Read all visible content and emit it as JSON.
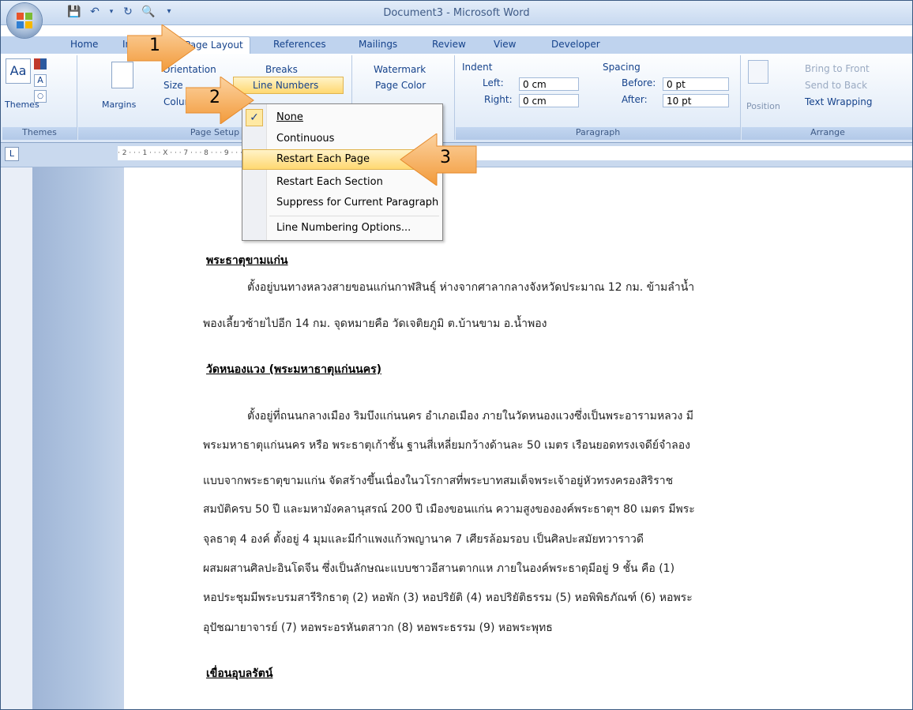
{
  "window": {
    "title": "Document3 - Microsoft Word"
  },
  "tabs": [
    "Home",
    "Insert",
    "Page Layout",
    "References",
    "Mailings",
    "Review",
    "View",
    "Developer"
  ],
  "tab_active": "Page Layout",
  "tab_insert_visible": "In",
  "ribbon": {
    "themes": {
      "button": "Themes",
      "group_label": "Themes"
    },
    "page_setup": {
      "margins": "Margins",
      "orientation": "Orientation",
      "size": "Size",
      "columns": "Columns",
      "breaks": "Breaks",
      "line_numbers": "Line Numbers",
      "group_label": "Page Setup"
    },
    "page_background": {
      "watermark": "Watermark",
      "page_color": "Page Color"
    },
    "paragraph": {
      "indent_label": "Indent",
      "left_label": "Left:",
      "left_value": "0 cm",
      "right_label": "Right:",
      "right_value": "0 cm",
      "spacing_label": "Spacing",
      "before_label": "Before:",
      "before_value": "0 pt",
      "after_label": "After:",
      "after_value": "10 pt",
      "group_label": "Paragraph"
    },
    "arrange": {
      "position": "Position",
      "bring_to_front": "Bring to Front",
      "send_to_back": "Send to Back",
      "text_wrapping": "Text Wrapping",
      "group_label": "Arrange"
    }
  },
  "ruler": {
    "marks": "· 2 · · · 1 · · · X · · · 7 · · · 8 · · · 9 · · · 10 · · · 11 · · · 12 · · · 13 · · · 14 · · · 15 · · ·△· · · 17 · · · 18 ·"
  },
  "line_numbers_menu": {
    "items": [
      "None",
      "Continuous",
      "Restart Each Page",
      "Restart Each Section",
      "Suppress for Current Paragraph",
      "Line Numbering Options..."
    ],
    "checked": "None",
    "highlighted": "Restart Each Page"
  },
  "callouts": [
    "1",
    "2",
    "3"
  ],
  "document": {
    "heading1": "พระธาตุขามแก่น",
    "p1_line1": "ตั้งอยู่บนทางหลวงสายขอนแก่นกาฬสินธุ์  ห่างจากศาลากลางจังหวัดประมาณ  12  กม.  ข้ามลำน้ำ",
    "p1_line2": "พองเลี้ยวซ้ายไปอีก 14 กม. จุดหมายคือ วัดเจติยภูมิ ต.บ้านขาม อ.น้ำพอง",
    "heading2": "วัดหนองแวง (พระมหาธาตุแก่นนคร)",
    "p2_lines": [
      "ตั้งอยู่ที่ถนนกลางเมือง  ริมบึงแก่นนคร  อำเภอเมือง  ภายในวัดหนองแวงซึ่งเป็นพระอารามหลวง  มี",
      "พระมหาธาตุแก่นนคร  หรือ  พระธาตุเก้าชั้น  ฐานสี่เหลี่ยมกว้างด้านละ  50  เมตร  เรือนยอดทรงเจดีย์จำลอง",
      "แบบจากพระธาตุขามแก่น             จัดสร้างขึ้นเนื่องในวโรกาสที่พระบาทสมเด็จพระเจ้าอยู่หัวทรงครองสิริราช",
      "สมบัติครบ 50 ปี และมหามังคลานุสรณ์ 200 ปี เมืองขอนแก่น ความสูงขององค์พระธาตุฯ 80 เมตร มีพระ",
      "จุลธาตุ  4  องค์  ตั้งอยู่  4  มุมและมีกำแพงแก้วพญานาค  7  เศียรล้อมรอบ  เป็นศิลปะสมัยทวาราวดี",
      "ผสมผสานศิลปะอินโดจีน  ซึ่งเป็นลักษณะแบบชาวอีสานตากแห  ภายในองค์พระธาตุมีอยู่  9  ชั้น  คือ  (1)",
      "หอประชุมมีพระบรมสารีริกธาตุ (2) หอพัก (3) หอปริยัติ (4) หอปริยัติธรรม (5) หอพิพิธภัณฑ์ (6) หอพระ",
      "อุปัชฌายาจารย์ (7) หอพระอรหันตสาวก (8) หอพระธรรม (9) หอพระพุทธ"
    ],
    "heading3": "เขื่อนอุบลรัตน์"
  },
  "colors": {
    "ribbon_text": "#15428b",
    "highlight": "#ffd871",
    "callout": "#f7a64a"
  }
}
